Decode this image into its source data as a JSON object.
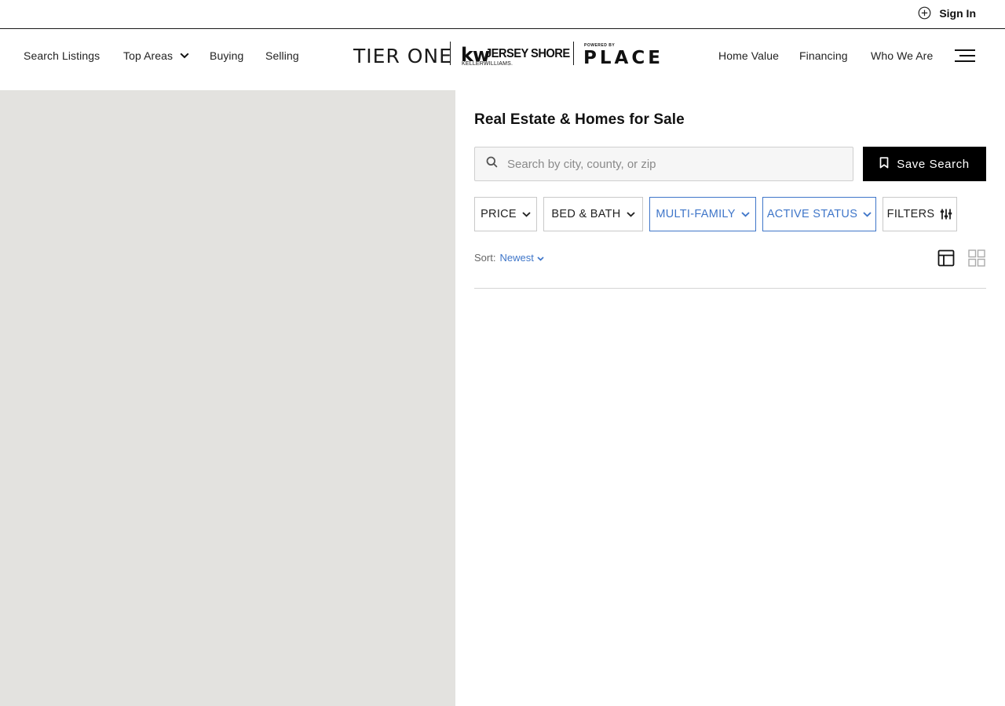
{
  "topbar": {
    "sign_in_label": "Sign In",
    "sign_in_icon": "plus-circle-icon"
  },
  "nav": {
    "left_items": [
      {
        "label": "Search Listings"
      },
      {
        "label": "Top Areas",
        "has_dropdown": true
      },
      {
        "label": "Buying"
      },
      {
        "label": "Selling"
      }
    ],
    "right_items": [
      {
        "label": "Home Value"
      },
      {
        "label": "Financing"
      },
      {
        "label": "Who We Are"
      }
    ],
    "menu_icon": "hamburger-icon"
  },
  "logo": {
    "tier": "TIER ONE",
    "kw": "kw",
    "jersey": "JERSEY SHORE",
    "keller": "KELLERWILLIAMS.",
    "powered_by": "POWERED BY",
    "place": "PLACE"
  },
  "map": {
    "background_color": "#e3e2df"
  },
  "panel": {
    "title": "Real Estate & Homes for Sale",
    "search": {
      "placeholder": "Search by city, county, or zip",
      "value": "",
      "icon": "search-icon"
    },
    "save_search": {
      "label": "Save Search",
      "icon": "bookmark-icon"
    },
    "filters": [
      {
        "label": "PRICE",
        "active": false,
        "icon": "chevron-down-icon"
      },
      {
        "label": "BED & BATH",
        "active": false,
        "icon": "chevron-down-icon"
      },
      {
        "label": "MULTI-FAMILY",
        "active": true,
        "icon": "chevron-down-icon"
      },
      {
        "label": "ACTIVE STATUS",
        "active": true,
        "icon": "chevron-down-icon"
      },
      {
        "label": "FILTERS",
        "active": false,
        "icon": "sliders-icon"
      }
    ],
    "sort": {
      "label": "Sort:",
      "value": "Newest"
    },
    "views": [
      {
        "name": "map-list-view",
        "icon": "layout-icon",
        "selected": true
      },
      {
        "name": "grid-view",
        "icon": "grid-icon",
        "selected": false
      }
    ]
  },
  "colors": {
    "accent": "#3f76c9",
    "button_dark": "#000000",
    "map_bg": "#e3e2df"
  }
}
